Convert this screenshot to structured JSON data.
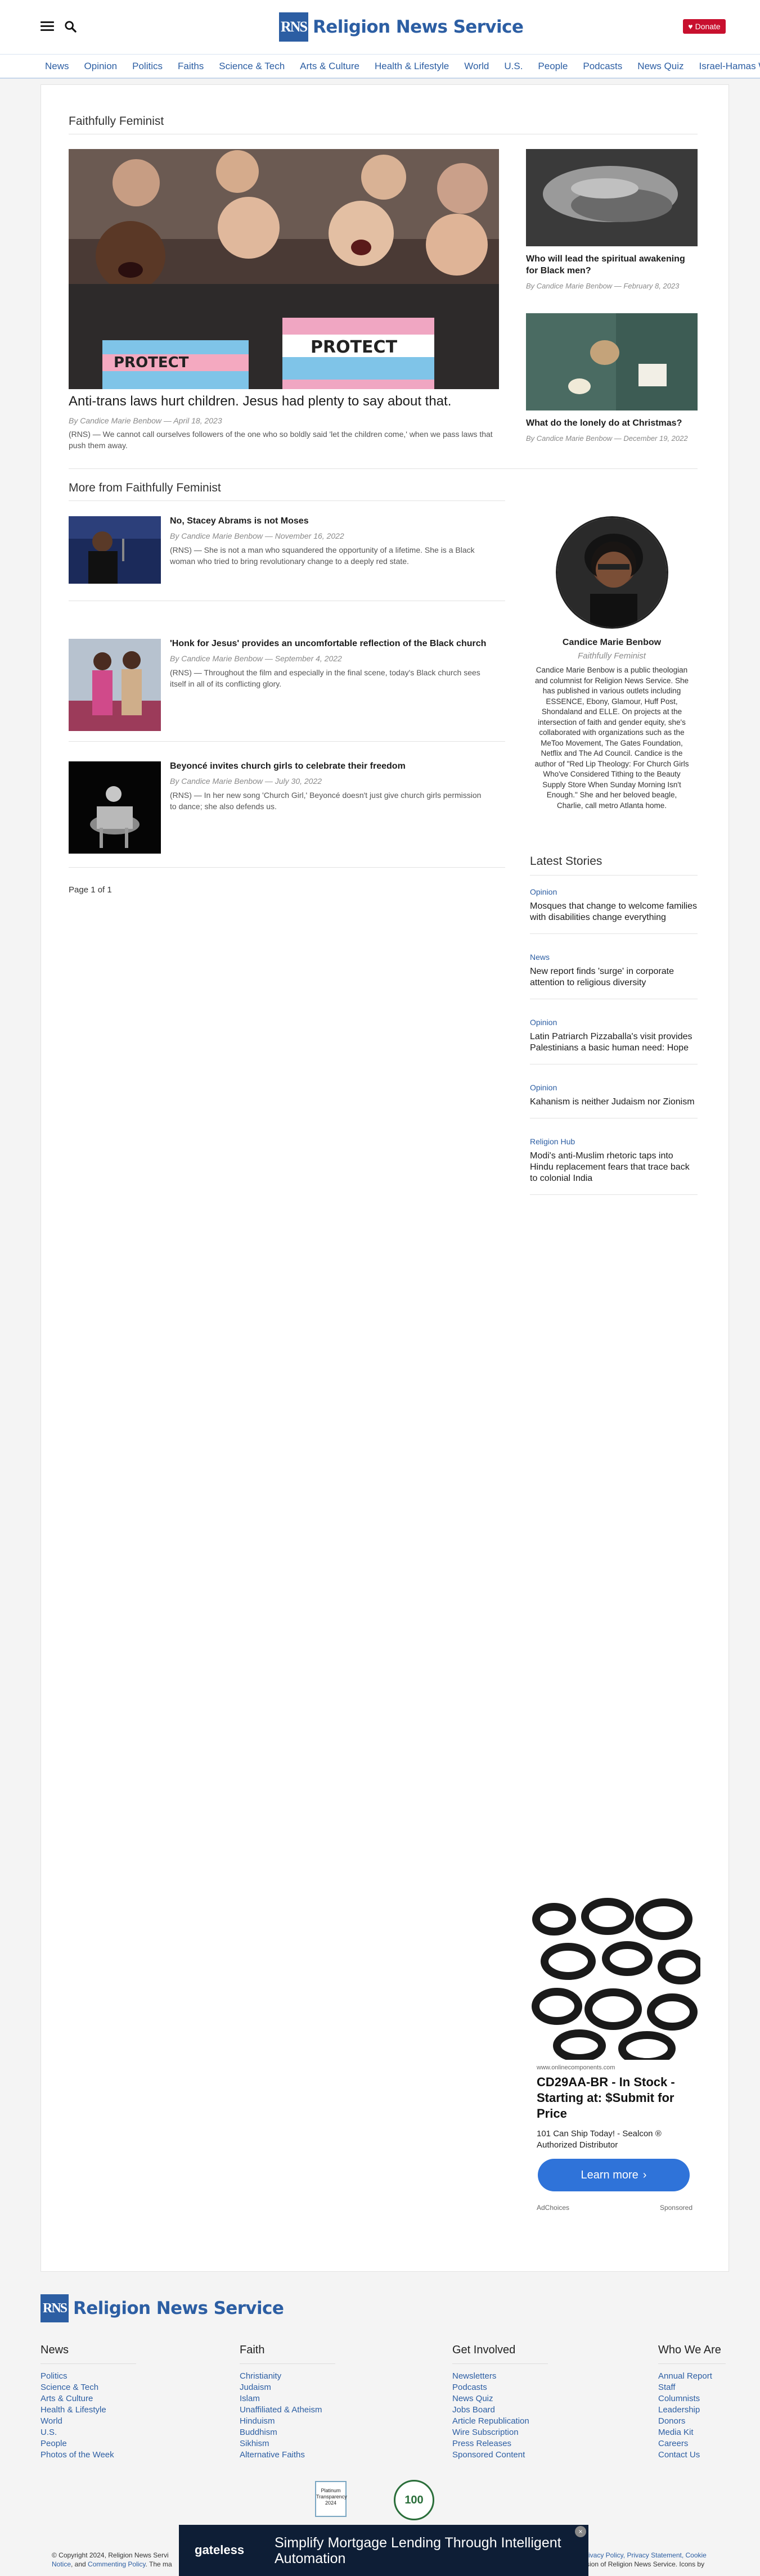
{
  "header": {
    "logo_mark": "RNS",
    "logo_text": "Religion News Service",
    "donate_label": "Donate",
    "icons": [
      "menu-icon",
      "search-icon",
      "heart-icon"
    ]
  },
  "nav": {
    "items": [
      "News",
      "Opinion",
      "Politics",
      "Faiths",
      "Science & Tech",
      "Arts & Culture",
      "Health & Lifestyle",
      "World",
      "U.S.",
      "People",
      "Podcasts",
      "News Quiz",
      "Israel-Hamas War"
    ]
  },
  "section": {
    "title": "Faithfully Feminist",
    "more_title": "More from Faithfully Feminist"
  },
  "featured": {
    "title": "Anti-trans laws hurt children. Jesus had plenty to say about that.",
    "byline": "By Candice Marie Benbow — April 18, 2023",
    "excerpt": "(RNS) — We cannot call ourselves followers of the one who so boldly said 'let the children come,' when we pass laws that push them away.",
    "sign_text_1": "PROTECT",
    "sign_text_2": "PROTECT TRANS"
  },
  "side_cards": [
    {
      "title": "Who will lead the spiritual awakening for Black men?",
      "byline": "By Candice Marie Benbow — February 8, 2023"
    },
    {
      "title": "What do the lonely do at Christmas?",
      "byline": "By Candice Marie Benbow — December 19, 2022"
    }
  ],
  "more_articles": [
    {
      "title": "No, Stacey Abrams is not Moses",
      "byline": "By Candice Marie Benbow — November 16, 2022",
      "excerpt": "(RNS) — She is not a man who squandered the opportunity of a lifetime. She is a Black woman who tried to bring revolutionary change to a deeply red state."
    },
    {
      "title": "'Honk for Jesus' provides an uncomfortable reflection of the Black church",
      "byline": "By Candice Marie Benbow — September 4, 2022",
      "excerpt": "(RNS) — Throughout the film and especially in the final scene, today's Black church sees itself in all of its conflicting glory."
    },
    {
      "title": "Beyoncé invites church girls to celebrate their freedom",
      "byline": "By Candice Marie Benbow — July 30, 2022",
      "excerpt": "(RNS) — In her new song 'Church Girl,' Beyoncé doesn't just give church girls permission to dance; she also defends us."
    }
  ],
  "pager": "Page 1 of 1",
  "author": {
    "name": "Candice Marie Benbow",
    "role": "Faithfully Feminist",
    "bio": "Candice Marie Benbow is a public theologian and columnist for Religion News Service. She has published in various outlets including ESSENCE, Ebony, Glamour, Huff Post, Shondaland and ELLE. On projects at the intersection of faith and gender equity, she's collaborated with organizations such as the MeToo Movement, The Gates Foundation, Netflix and The Ad Council. Candice is the author of \"Red Lip Theology: For Church Girls Who've Considered Tithing to the Beauty Supply Store When Sunday Morning Isn't Enough.\" She and her beloved beagle, Charlie, call metro Atlanta home."
  },
  "latest": {
    "title": "Latest Stories",
    "items": [
      {
        "category": "Opinion",
        "headline": "Mosques that change to welcome families with disabilities change everything"
      },
      {
        "category": "News",
        "headline": "New report finds 'surge' in corporate attention to religious diversity"
      },
      {
        "category": "Opinion",
        "headline": "Latin Patriarch Pizzaballa's visit provides Palestinians a basic human need: Hope"
      },
      {
        "category": "Opinion",
        "headline": "Kahanism is neither Judaism nor Zionism"
      },
      {
        "category": "Religion Hub",
        "headline": "Modi's anti-Muslim rhetoric taps into Hindu replacement fears that trace back to colonial India"
      }
    ]
  },
  "ad": {
    "domain": "www.onlinecomponents.com",
    "headline": "CD29AA-BR - In Stock - Starting at: $Submit for Price",
    "sub": "101 Can Ship Today! - Sealcon ® Authorized Distributor",
    "button": "Learn more",
    "adchoices": "AdChoices",
    "sponsored": "Sponsored"
  },
  "footer": {
    "logo_mark": "RNS",
    "logo_text": "Religion News Service",
    "columns": [
      {
        "title": "News",
        "links": [
          "Politics",
          "Science & Tech",
          "Arts & Culture",
          "Health & Lifestyle",
          "World",
          "U.S.",
          "People",
          "Photos of the Week"
        ]
      },
      {
        "title": "Faith",
        "links": [
          "Christianity",
          "Judaism",
          "Islam",
          "Unaffiliated & Atheism",
          "Hinduism",
          "Buddhism",
          "Sikhism",
          "Alternative Faiths"
        ]
      },
      {
        "title": "Get Involved",
        "links": [
          "Newsletters",
          "Podcasts",
          "News Quiz",
          "Jobs Board",
          "Article Republication",
          "Wire Subscription",
          "Press Releases",
          "Sponsored Content"
        ]
      },
      {
        "title": "Who We Are",
        "links": [
          "Annual Report",
          "Staff",
          "Columnists",
          "Leadership",
          "Donors",
          "Media Kit",
          "Careers",
          "Contact Us"
        ]
      }
    ],
    "badge_1": "Platinum Transparency 2024",
    "badge_2": "100",
    "copyright_prefix": "© Copyright 2024, Religion News Servi",
    "copyright_links_1": "Notice",
    "copyright_and": ", and ",
    "copyright_links_2": "Commenting Policy",
    "copyright_suffix": ". The ma",
    "copyright_right": "rivacy Policy, Privacy Statement, Cookie",
    "copyright_right2": "sion of Religion News Service. Icons by"
  },
  "bottom_banner": {
    "brand": "gateless",
    "text": "Simplify Mortgage Lending Through Intelligent Automation",
    "close": "×"
  }
}
